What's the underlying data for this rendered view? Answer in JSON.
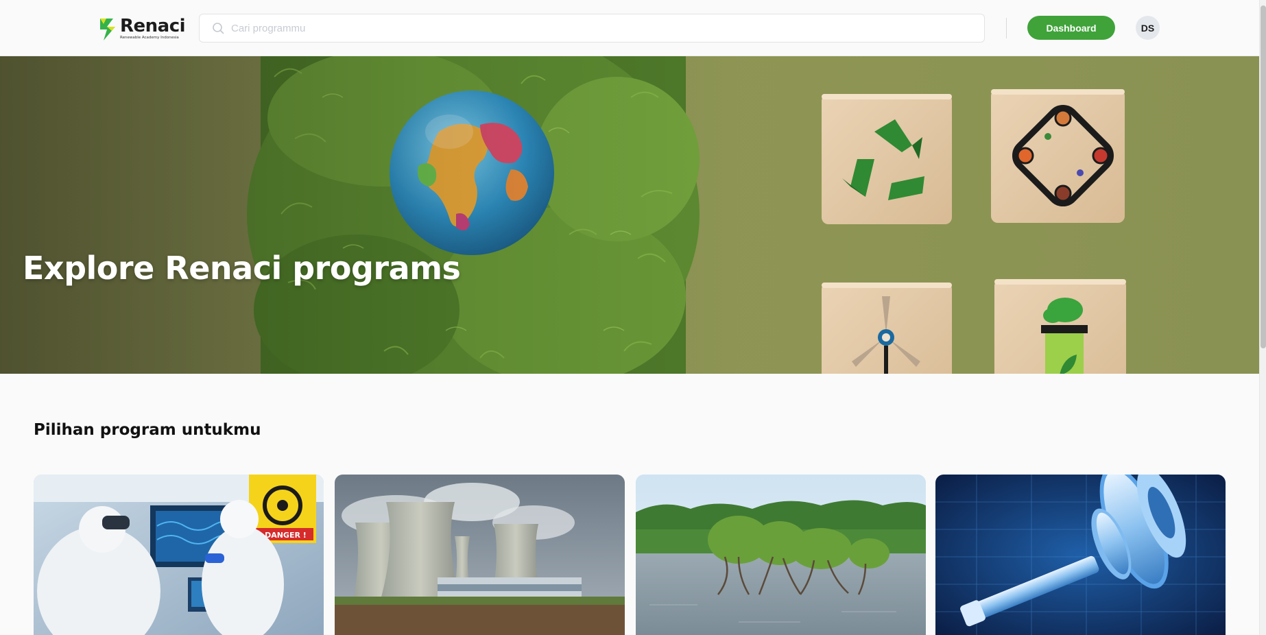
{
  "header": {
    "logo_title": "Renaci",
    "logo_subtitle": "Renewable Academy Indonesia",
    "search_placeholder": "Cari programmu",
    "dashboard_label": "Dashboard",
    "avatar_initials": "DS"
  },
  "hero": {
    "title": "Explore Renaci programs"
  },
  "section": {
    "title": "Pilihan program untukmu"
  },
  "cards": [
    {
      "image": "lab-scientists-biohazard"
    },
    {
      "image": "cooling-towers-power-plant"
    },
    {
      "image": "mangroves-in-water"
    },
    {
      "image": "gear-shaft-blueprint"
    }
  ],
  "colors": {
    "accent": "#3fa33a",
    "logo_green": "#35b34a",
    "logo_yellow": "#d7e31f",
    "hero_bg": "#8a9150",
    "page_bg": "#fafafa"
  },
  "icons": {
    "search": "search-icon",
    "logo": "renaci-logo-icon"
  }
}
